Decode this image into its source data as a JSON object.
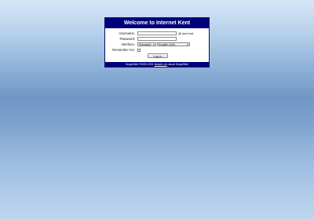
{
  "header": {
    "title": "Welcome to Internet Kent"
  },
  "form": {
    "username_label": "Username:",
    "username_value": "",
    "domain_suffix": "@ kent.net",
    "password_label": "Password:",
    "password_value": "",
    "interface_label": "Interface:",
    "interface_value": "Standard",
    "language_value": "English (UK)",
    "remember_label": "Remember me:",
    "remember_checked": false,
    "login_button": "Log in"
  },
  "footer": {
    "copyright": "SurgeWeb ©2000-2021",
    "company_link": "Netwin Ltd",
    "about_link": "about SurgeWeb"
  }
}
